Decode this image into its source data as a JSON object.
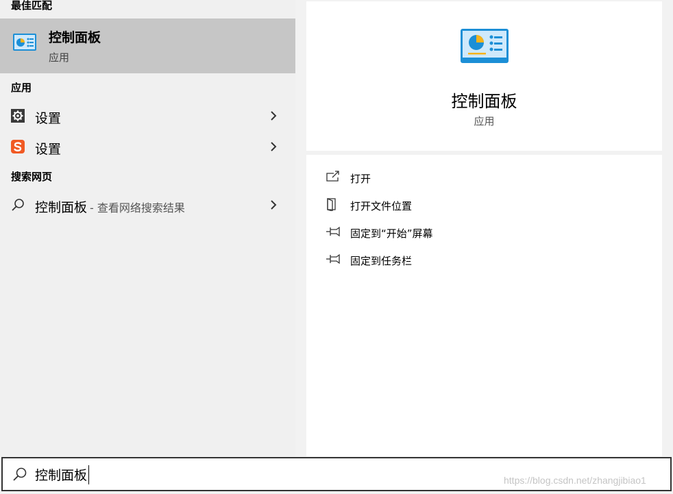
{
  "left": {
    "best_match_header": "最佳匹配",
    "best_match": {
      "title": "控制面板",
      "subtitle": "应用",
      "icon": "control-panel-icon"
    },
    "apps_header": "应用",
    "apps": [
      {
        "label": "设置",
        "icon": "gear-icon"
      },
      {
        "label": "设置",
        "icon": "sogou-icon"
      }
    ],
    "web_header": "搜索网页",
    "web_result": {
      "label": "控制面板",
      "suffix": "- 查看网络搜索结果",
      "icon": "search-icon"
    }
  },
  "detail": {
    "title": "控制面板",
    "subtitle": "应用",
    "actions": [
      {
        "label": "打开",
        "icon": "open-icon"
      },
      {
        "label": "打开文件位置",
        "icon": "file-location-icon"
      },
      {
        "label": "固定到“开始”屏幕",
        "icon": "pin-icon"
      },
      {
        "label": "固定到任务栏",
        "icon": "pin-icon"
      }
    ]
  },
  "search": {
    "value": "控制面板",
    "icon": "search-icon"
  },
  "watermark": "https://blog.csdn.net/zhangjibiao1",
  "colors": {
    "selected": "#c6c6c6",
    "pane": "#f0f0f0",
    "accent": "#1c8fd6",
    "sogou": "#f15a24"
  }
}
